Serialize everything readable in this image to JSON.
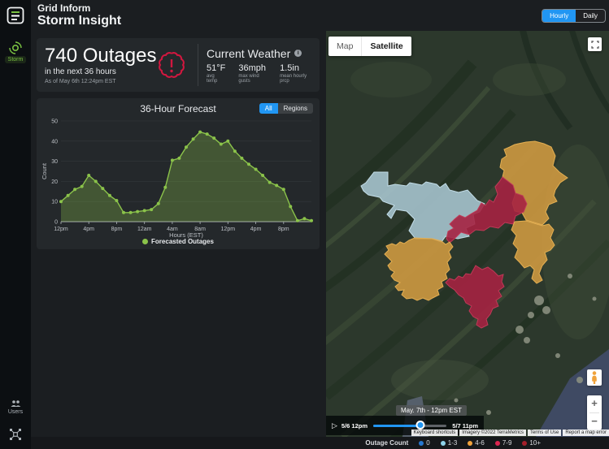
{
  "app": {
    "product": "Grid Inform",
    "page": "Storm Insight"
  },
  "header": {
    "view_toggle": {
      "options": [
        "Hourly",
        "Daily"
      ],
      "selected": "Hourly"
    }
  },
  "sidebar": {
    "storm": "Storm",
    "users": "Users"
  },
  "stats": {
    "headline": "740 Outages",
    "subline": "in the next 36 hours",
    "as_of": "As of May 6th 12:24pm EST",
    "weather": {
      "title": "Current Weather",
      "metrics": [
        {
          "value": "51°F",
          "label": "avg temp"
        },
        {
          "value": "36mph",
          "label": "max wind gusts"
        },
        {
          "value": "1.5in",
          "label": "mean hourly prcp"
        }
      ]
    }
  },
  "chart": {
    "toggle": {
      "options": [
        "All",
        "Regions"
      ],
      "selected": "All"
    },
    "legend": "Forecasted Outages"
  },
  "chart_data": {
    "type": "area",
    "title": "36-Hour Forecast",
    "xlabel": "Hours (EST)",
    "ylabel": "Count",
    "ylim": [
      0,
      50
    ],
    "y_ticks": [
      0,
      10,
      20,
      30,
      40,
      50
    ],
    "x_tick_every": 4,
    "x_tick_labels": [
      "12pm",
      "4pm",
      "8pm",
      "12am",
      "4am",
      "8am",
      "12pm",
      "4pm",
      "8pm"
    ],
    "legend": "Forecasted Outages",
    "line_color": "#8bc34a",
    "fill_color": "rgba(139,195,74,0.30)",
    "series": [
      {
        "name": "Forecasted Outages",
        "values": [
          10,
          13,
          16,
          17.5,
          23,
          20,
          16.5,
          13,
          10.5,
          4.5,
          4.5,
          5,
          5.5,
          6,
          9,
          17,
          30.5,
          31.5,
          37,
          41,
          44.5,
          43.5,
          41.5,
          38.5,
          40,
          35,
          31.5,
          28.5,
          26,
          23,
          19.5,
          18,
          16,
          7.5,
          0.5,
          1.5,
          0.5
        ]
      }
    ]
  },
  "map": {
    "type_toggle": {
      "options": [
        "Map",
        "Satellite"
      ],
      "selected": "Satellite"
    },
    "regions": [
      {
        "id": "north-central",
        "color": "#a9c6d2",
        "stroke": "#c3dde8"
      },
      {
        "id": "northeast",
        "color": "#d29b41",
        "stroke": "#e4af52"
      },
      {
        "id": "central",
        "color": "#a52241",
        "stroke": "#bf3a57"
      },
      {
        "id": "east",
        "color": "#d29b41",
        "stroke": "#e4af52"
      },
      {
        "id": "southwest",
        "color": "#d29b41",
        "stroke": "#e4af52"
      },
      {
        "id": "south",
        "color": "#a52241",
        "stroke": "#bf3a57"
      }
    ],
    "timeline": {
      "start_label": "5/6 12pm",
      "end_label": "5/7 11pm",
      "tooltip": "May. 7th - 12pm EST",
      "progress": 0.64
    },
    "attribution": [
      "Keyboard shortcuts",
      "Imagery ©2022 TerraMetrics",
      "Terms of Use",
      "Report a map error"
    ]
  },
  "legend_bar": {
    "title": "Outage Count",
    "items": [
      {
        "label": "0",
        "color": "#2878d0"
      },
      {
        "label": "1-3",
        "color": "#8fd3ea"
      },
      {
        "label": "4-6",
        "color": "#f2a33c"
      },
      {
        "label": "7-9",
        "color": "#dc2650"
      },
      {
        "label": "10+",
        "color": "#a51f2b"
      }
    ]
  }
}
